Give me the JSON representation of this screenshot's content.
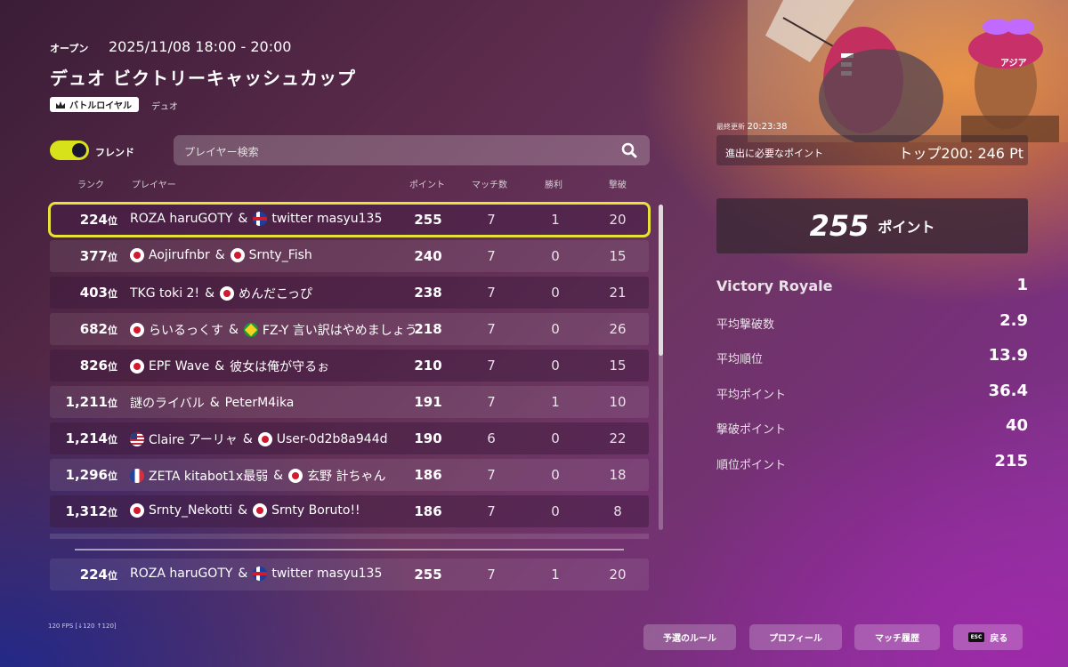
{
  "header": {
    "status": "オープン",
    "datetime": "2025/11/08 18:00 - 20:00",
    "title": "デュオ ビクトリーキャッシュカップ",
    "mode_badge": "バトルロイヤル",
    "mode_sub": "デュオ"
  },
  "filters": {
    "friends_label": "フレンド",
    "friends_on": true,
    "search_placeholder": "プレイヤー検索"
  },
  "columns": {
    "rank": "ランク",
    "player": "プレイヤー",
    "points": "ポイント",
    "matches": "マッチ数",
    "wins": "勝利",
    "elims": "撃破"
  },
  "rank_suffix": "位",
  "rows": [
    {
      "rank": "224",
      "p1_flag": "",
      "p1": "ROZA haruGOTY",
      "p2_flag": "is",
      "p2": "twitter masyu135",
      "points": "255",
      "matches": "7",
      "wins": "1",
      "elims": "20",
      "selected": true
    },
    {
      "rank": "377",
      "p1_flag": "jp",
      "p1": "Aojirufnbr",
      "p2_flag": "jp",
      "p2": "Srnty_Fish",
      "points": "240",
      "matches": "7",
      "wins": "0",
      "elims": "15"
    },
    {
      "rank": "403",
      "p1_flag": "",
      "p1": "TKG toki 2!",
      "p2_flag": "jp",
      "p2": "めんだこっぴ",
      "points": "238",
      "matches": "7",
      "wins": "0",
      "elims": "21"
    },
    {
      "rank": "682",
      "p1_flag": "jp",
      "p1": "らいるっくす",
      "p2_flag": "br",
      "p2": "FZ-Y 言い訳はやめましょう",
      "points": "218",
      "matches": "7",
      "wins": "0",
      "elims": "26"
    },
    {
      "rank": "826",
      "p1_flag": "jp",
      "p1": "EPF Wave",
      "p2_flag": "",
      "p2": "彼女は俺が守るぉ",
      "points": "210",
      "matches": "7",
      "wins": "0",
      "elims": "15"
    },
    {
      "rank": "1,211",
      "p1_flag": "",
      "p1": "謎のライバル",
      "p2_flag": "",
      "p2": "PeterM4ika",
      "points": "191",
      "matches": "7",
      "wins": "1",
      "elims": "10"
    },
    {
      "rank": "1,214",
      "p1_flag": "us",
      "p1": "Claire アーリャ",
      "p2_flag": "jp",
      "p2": "User-0d2b8a944d",
      "points": "190",
      "matches": "6",
      "wins": "0",
      "elims": "22"
    },
    {
      "rank": "1,296",
      "p1_flag": "fr",
      "p1": "ZETA kitabot1x最弱",
      "p2_flag": "jp",
      "p2": "玄野 計ちゃん",
      "points": "186",
      "matches": "7",
      "wins": "0",
      "elims": "18"
    },
    {
      "rank": "1,312",
      "p1_flag": "jp",
      "p1": "Srnty_Nekotti",
      "p2_flag": "jp",
      "p2": "Srnty Boruto!!",
      "points": "186",
      "matches": "7",
      "wins": "0",
      "elims": "8"
    }
  ],
  "pinned_row": {
    "rank": "224",
    "p1_flag": "",
    "p1": "ROZA haruGOTY",
    "p2_flag": "is",
    "p2": "twitter masyu135",
    "points": "255",
    "matches": "7",
    "wins": "1",
    "elims": "20"
  },
  "scroll_position": 0,
  "side": {
    "region": "アジア",
    "updated_label": "最終更新",
    "updated_time": "20:23:38",
    "need_label": "進出に必要なポイント",
    "need_value": "トップ200: 246 Pt",
    "points": "255",
    "points_unit": "ポイント",
    "stats": [
      {
        "label": "Victory Royale",
        "value": "1",
        "big": true
      },
      {
        "label": "平均撃破数",
        "value": "2.9"
      },
      {
        "label": "平均順位",
        "value": "13.9"
      },
      {
        "label": "平均ポイント",
        "value": "36.4"
      },
      {
        "label": "撃破ポイント",
        "value": "40"
      },
      {
        "label": "順位ポイント",
        "value": "215"
      }
    ]
  },
  "footer": {
    "fps": "120 FPS [↓120 ↑120]",
    "rules": "予選のルール",
    "profile": "プロフィール",
    "history": "マッチ履歴",
    "back_key": "ESC",
    "back": "戻る"
  },
  "colors": {
    "accent_yellow": "#e7e23a",
    "toggle": "#d7e21a"
  }
}
